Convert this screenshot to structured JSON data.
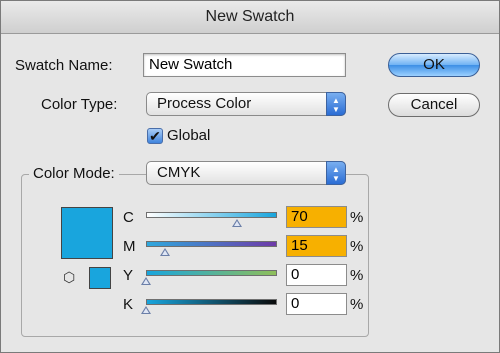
{
  "dialog": {
    "title": "New Swatch"
  },
  "swatch_name": {
    "label": "Swatch Name:",
    "value": "New Swatch"
  },
  "color_type": {
    "label": "Color Type:",
    "selected": "Process Color"
  },
  "global_checkbox": {
    "label": "Global",
    "checked": true
  },
  "color_mode": {
    "label": "Color Mode:",
    "selected": "CMYK"
  },
  "buttons": {
    "ok": "OK",
    "cancel": "Cancel"
  },
  "swatch_color": "#19a5dd",
  "channels": [
    {
      "name": "C",
      "value": "70",
      "unit": "%",
      "highlighted": true
    },
    {
      "name": "M",
      "value": "15",
      "unit": "%",
      "highlighted": true
    },
    {
      "name": "Y",
      "value": "0",
      "unit": "%",
      "highlighted": false
    },
    {
      "name": "K",
      "value": "0",
      "unit": "%",
      "highlighted": false
    }
  ],
  "icons": {
    "out_of_gamut": "cube-icon",
    "popup_arrows": "updown-arrows-icon"
  }
}
